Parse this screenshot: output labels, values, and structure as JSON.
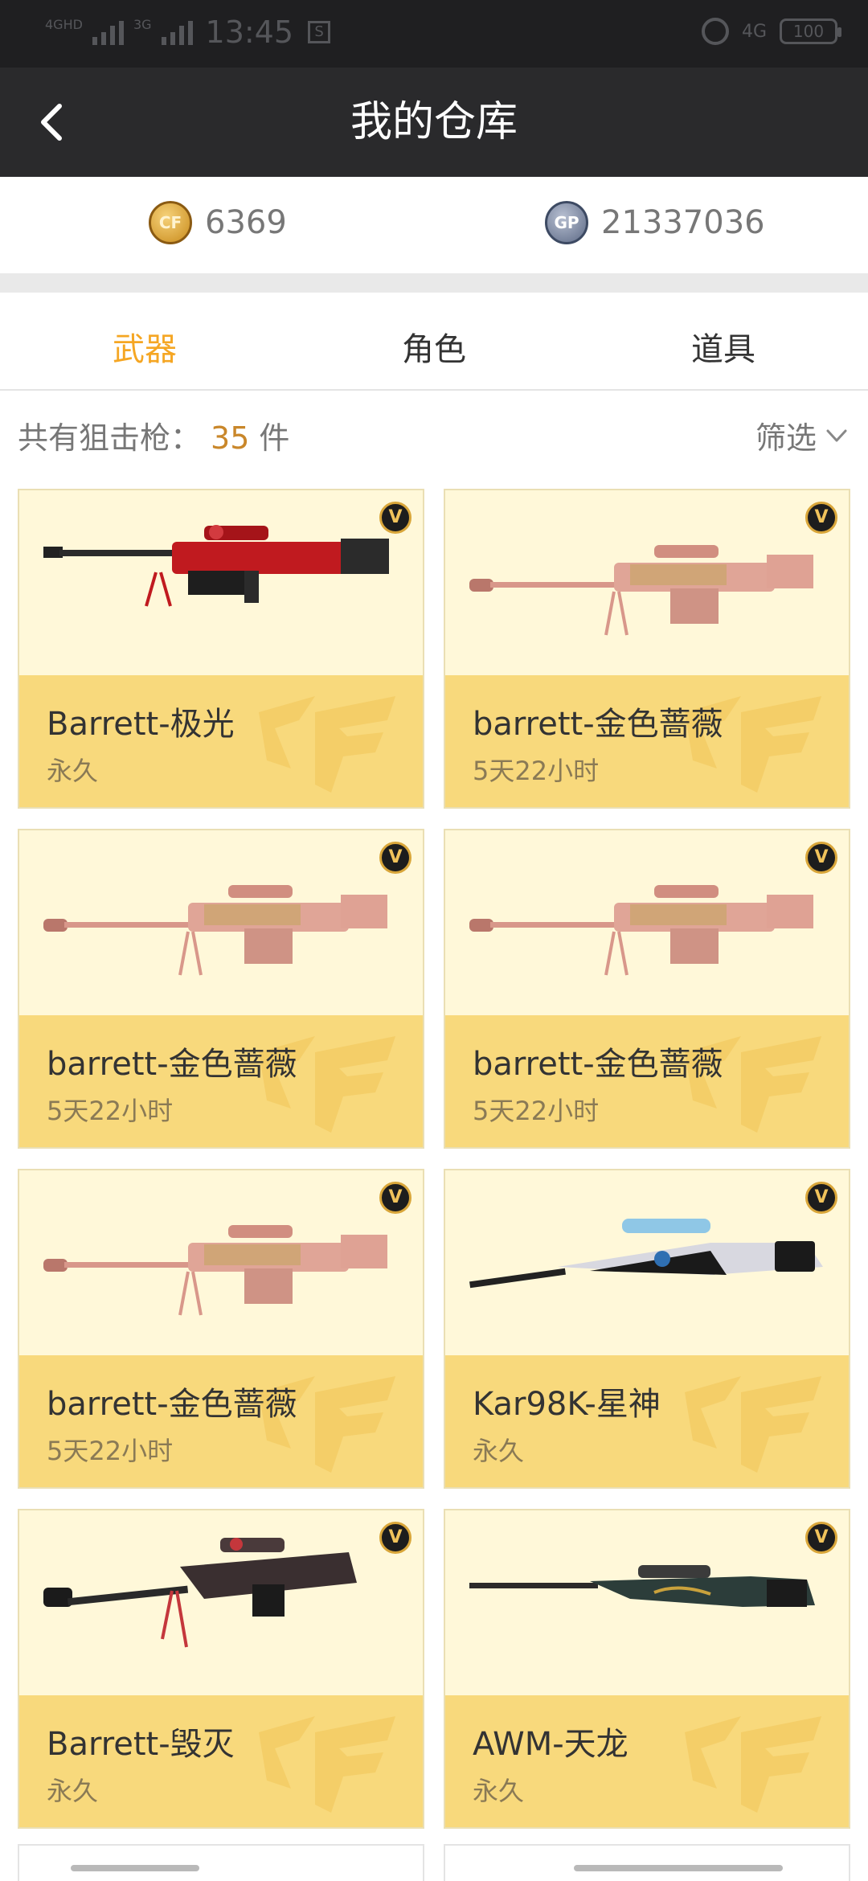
{
  "status_bar": {
    "network_left": "4GHD",
    "network_mid": "3G",
    "time": "13:45",
    "network_right": "4G",
    "battery": "100"
  },
  "nav": {
    "title": "我的仓库"
  },
  "balance": {
    "cf_coin_label": "CF",
    "cf_coins": "6369",
    "gp_label": "GP",
    "gp_points": "21337036"
  },
  "tabs": [
    {
      "label": "武器",
      "active": true
    },
    {
      "label": "角色",
      "active": false
    },
    {
      "label": "道具",
      "active": false
    }
  ],
  "summary": {
    "prefix": "共有狙击枪：",
    "count": "35",
    "unit": "件",
    "filter_label": "筛选"
  },
  "vip_badge": "V",
  "items": [
    {
      "name": "Barrett-极光",
      "duration": "永久",
      "gun": "barrett-red"
    },
    {
      "name": "barrett-金色蔷薇",
      "duration": "5天22小时",
      "gun": "barrett-rose"
    },
    {
      "name": "barrett-金色蔷薇",
      "duration": "5天22小时",
      "gun": "barrett-rose"
    },
    {
      "name": "barrett-金色蔷薇",
      "duration": "5天22小时",
      "gun": "barrett-rose"
    },
    {
      "name": "barrett-金色蔷薇",
      "duration": "5天22小时",
      "gun": "barrett-rose"
    },
    {
      "name": "Kar98K-星神",
      "duration": "永久",
      "gun": "kar98k"
    },
    {
      "name": "Barrett-毁灭",
      "duration": "永久",
      "gun": "barrett-black"
    },
    {
      "name": "AWM-天龙",
      "duration": "永久",
      "gun": "awm"
    }
  ],
  "colors": {
    "accent": "#f5a623",
    "card_top": "#fff8d9",
    "card_bottom": "#f8d97c",
    "nav_bg": "#2a2a2c"
  }
}
